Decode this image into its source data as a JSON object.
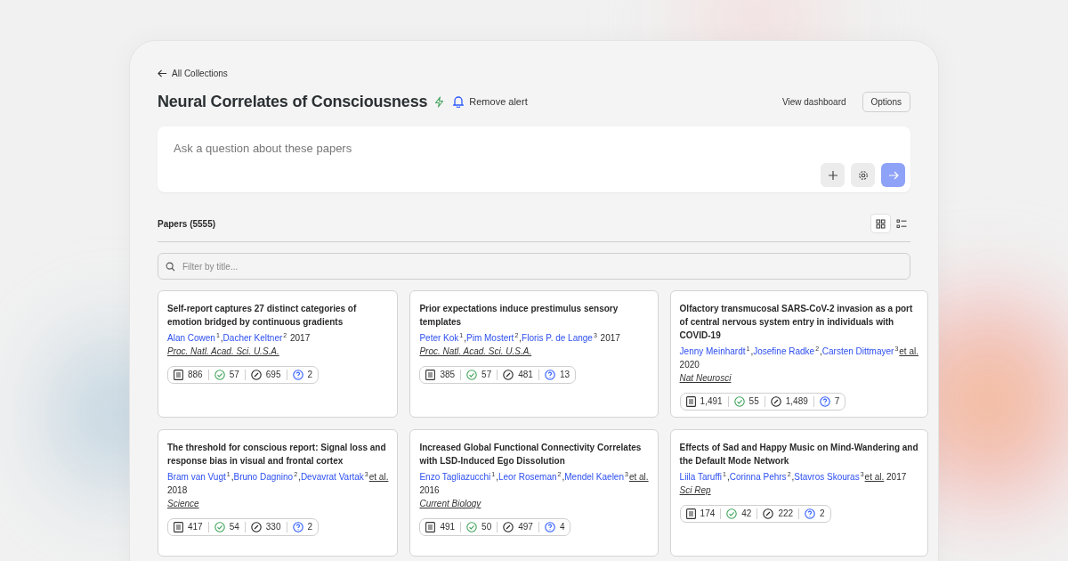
{
  "back_link": "All Collections",
  "title": "Neural Correlates of Consciousness",
  "alert_button": "Remove alert",
  "header_actions": [
    {
      "label": "View dashboard",
      "kind": "link"
    },
    {
      "label": "Options",
      "kind": "button"
    }
  ],
  "ask": {
    "placeholder": "Ask a question about these papers"
  },
  "papers_heading": "Papers (5555)",
  "views": [
    {
      "kind": "grid",
      "selected": true
    },
    {
      "kind": "list",
      "selected": false
    }
  ],
  "filter": {
    "placeholder": "Filter by title..."
  },
  "papers": [
    {
      "title": "Self-report captures 27 distinct categories of emotion bridged by continuous gradients",
      "authors": [
        {
          "name": "Alan Cowen",
          "sup": "1",
          "sep": ","
        },
        {
          "name": "Dacher Keltner",
          "sup": "2"
        }
      ],
      "year": "2017",
      "journal": "Proc. Natl. Acad. Sci. U.S.A.",
      "stats": {
        "papers": "886",
        "supporting": "57",
        "contrasting": "695",
        "questions": "2"
      }
    },
    {
      "title": "Prior expectations induce prestimulus sensory templates",
      "authors": [
        {
          "name": "Peter Kok",
          "sup": "1",
          "sep": ","
        },
        {
          "name": "Pim Mostert",
          "sup": "2",
          "sep": ","
        },
        {
          "name": "Floris P. de Lange",
          "sup": "3"
        }
      ],
      "year": "2017",
      "journal": "Proc. Natl. Acad. Sci. U.S.A.",
      "stats": {
        "papers": "385",
        "supporting": "57",
        "contrasting": "481",
        "questions": "13"
      }
    },
    {
      "title": "Olfactory transmucosal SARS-CoV-2 invasion as a port of central nervous system entry in individuals with COVID-19",
      "authors": [
        {
          "name": "Jenny Meinhardt",
          "sup": "1",
          "sep": ","
        },
        {
          "name": "Josefine Radke",
          "sup": "2",
          "sep": ","
        },
        {
          "name": "Carsten Dittmayer",
          "sup": "3"
        }
      ],
      "et_al": "et al.",
      "year": "2020",
      "journal": "Nat Neurosci",
      "stats": {
        "papers": "1,491",
        "supporting": "55",
        "contrasting": "1,489",
        "questions": "7"
      }
    },
    {
      "title": "The threshold for conscious report: Signal loss and response bias in visual and frontal cortex",
      "authors": [
        {
          "name": "Bram van Vugt",
          "sup": "1",
          "sep": ","
        },
        {
          "name": "Bruno Dagnino",
          "sup": "2",
          "sep": ","
        },
        {
          "name": "Devavrat Vartak",
          "sup": "3"
        }
      ],
      "et_al": "et al.",
      "year": "2018",
      "journal": "Science",
      "stats": {
        "papers": "417",
        "supporting": "54",
        "contrasting": "330",
        "questions": "2"
      }
    },
    {
      "title": "Increased Global Functional Connectivity Correlates with LSD-Induced Ego Dissolution",
      "authors": [
        {
          "name": "Enzo Tagliazucchi",
          "sup": "1",
          "sep": ","
        },
        {
          "name": "Leor Roseman",
          "sup": "2",
          "sep": ","
        },
        {
          "name": "Mendel Kaelen",
          "sup": "3"
        }
      ],
      "et_al": "et al.",
      "year": "2016",
      "journal": "Current Biology",
      "stats": {
        "papers": "491",
        "supporting": "50",
        "contrasting": "497",
        "questions": "4"
      }
    },
    {
      "title": "Effects of Sad and Happy Music on Mind-Wandering and the Default Mode Network",
      "authors": [
        {
          "name": "Liila Taruffi",
          "sup": "1",
          "sep": ","
        },
        {
          "name": "Corinna Pehrs",
          "sup": "2",
          "sep": ","
        },
        {
          "name": "Stavros Skouras",
          "sup": "3"
        }
      ],
      "et_al": "et al.",
      "year": "2017",
      "journal": "Sci Rep",
      "stats": {
        "papers": "174",
        "supporting": "42",
        "contrasting": "222",
        "questions": "2"
      }
    }
  ]
}
